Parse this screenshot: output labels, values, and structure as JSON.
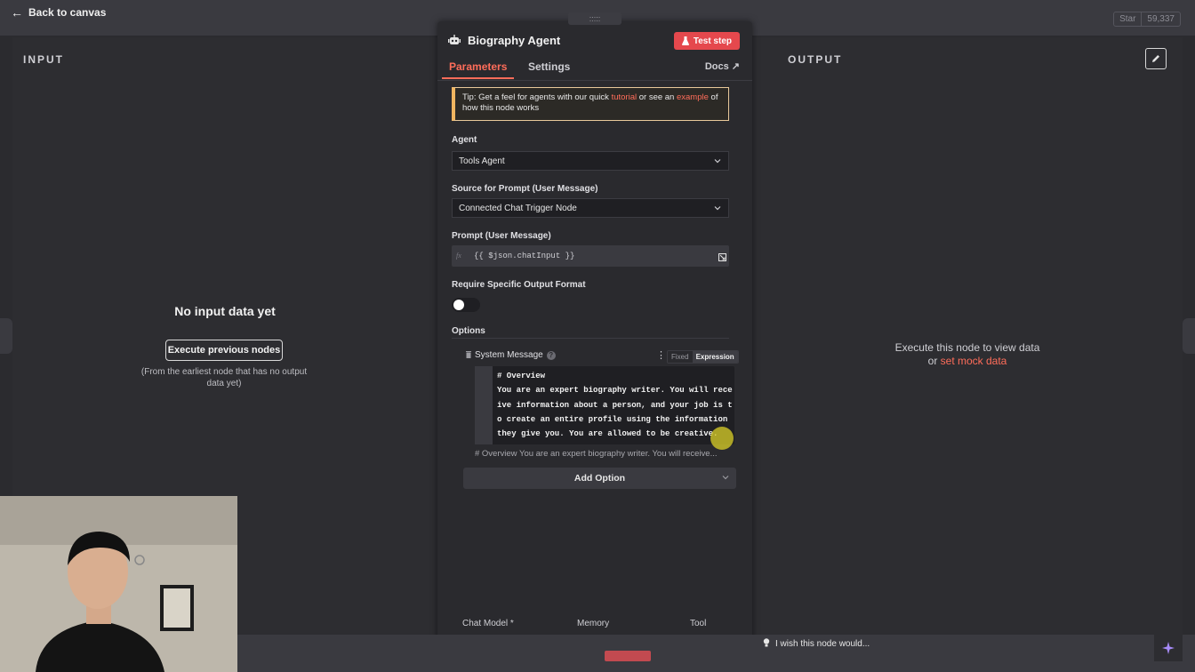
{
  "header": {
    "back_label": "Back to canvas",
    "github_star": "Star",
    "github_count": "59,337"
  },
  "input_panel": {
    "title": "INPUT",
    "empty_title": "No input data yet",
    "execute_button": "Execute previous nodes",
    "hint": "(From the earliest node that has no output data yet)"
  },
  "output_panel": {
    "title": "OUTPUT",
    "message": "Execute this node to view data",
    "or_text": "or",
    "mock_link": "set mock data"
  },
  "node": {
    "title": "Biography Agent",
    "drag_handle": ":::::",
    "test_step": "Test step",
    "tabs": [
      "Parameters",
      "Settings"
    ],
    "docs_label": "Docs",
    "tip": {
      "prefix": "Tip: Get a feel for agents with our quick ",
      "tutorial": "tutorial",
      "middle": " or see an ",
      "example": "example",
      "suffix": " of how this node works"
    },
    "agent_label": "Agent",
    "agent_value": "Tools Agent",
    "source_label": "Source for Prompt (User Message)",
    "source_value": "Connected Chat Trigger Node",
    "prompt_label": "Prompt (User Message)",
    "prompt_value": "{{ $json.chatInput }}",
    "fx_label": "fx",
    "output_format_label": "Require Specific Output Format",
    "output_format_enabled": false,
    "options_label": "Options",
    "system_message_label": "System Message",
    "help_mark": "?",
    "mode_fixed": "Fixed",
    "mode_expression": "Expression",
    "system_message_code": "# Overview\nYou are an expert biography writer. You will receive information about a person, and your job is to create an entire profile using the information they give you. You are allowed to be creative.",
    "system_message_preview": "# Overview You are an expert biography writer. You will receive...",
    "add_option": "Add Option",
    "connections": [
      {
        "label": "Chat Model *"
      },
      {
        "label": "Memory"
      },
      {
        "label": "Tool"
      }
    ]
  },
  "footer": {
    "wish_text": "I wish this node would..."
  },
  "colors": {
    "accent": "#ff6d5a",
    "test_button": "#e5484d",
    "tip_border": "#f0b560"
  }
}
